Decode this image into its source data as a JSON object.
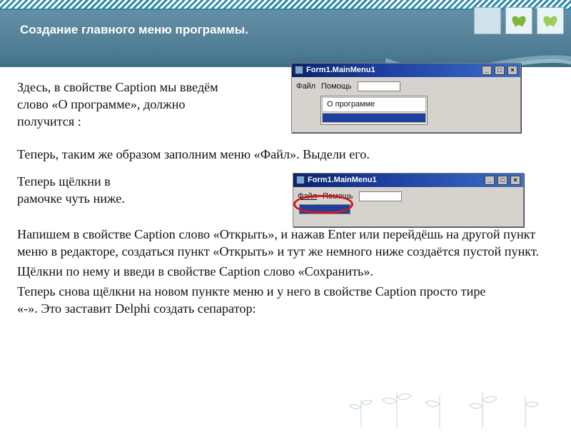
{
  "header": {
    "title": "Создание главного меню программы."
  },
  "body": {
    "p1a": "Здесь, в свойстве Caption мы введём",
    "p1b": " слово «О программе», должно",
    "p1c": " получится :",
    "p2": "Теперь, таким же образом заполним меню «Файл». Выдели его.",
    "p3a": "Теперь щёлкни в",
    "p3b": "рамочке чуть ниже.",
    "p4": "Напишем в свойстве Caption слово «Открыть», и нажав Enter или перейдёшь на другой пункт меню в редакторе, создаться пункт «Открыть» и тут же немного ниже создаётся пустой пункт.",
    "p5": "Щёлкни по нему и введи в свойстве Caption слово «Сохранить».",
    "p6": "Теперь снова щёлкни на новом пункте меню и у него в свойстве Caption просто тире",
    "p7": "«-». Это заставит Delphi создать сепаратор:"
  },
  "win1": {
    "title": "Form1.MainMenu1",
    "menu_file": "Файл",
    "menu_help": "Помощь",
    "submenu_about": "О программе"
  },
  "win2": {
    "title": "Form1.MainMenu1",
    "menu_file": "Файл",
    "menu_help": "Помощь"
  }
}
